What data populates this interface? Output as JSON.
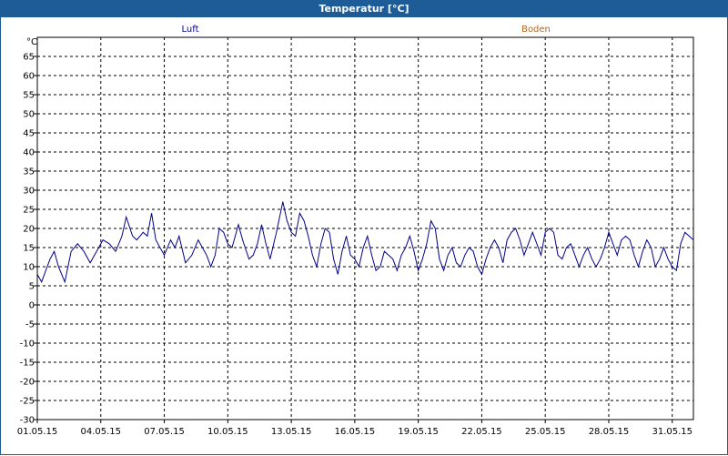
{
  "window": {
    "title": "Temperatur [°C]"
  },
  "chart_data": {
    "type": "line",
    "title": "Temperatur [°C]",
    "ylabel": "°C",
    "xlabel": "",
    "ylim": [
      -30,
      70
    ],
    "xlim": [
      0,
      31
    ],
    "grid": true,
    "legend_placement": "top",
    "yticks": [
      65,
      60,
      55,
      50,
      45,
      40,
      35,
      30,
      25,
      20,
      15,
      10,
      5,
      0,
      -5,
      -10,
      -15,
      -20,
      -25,
      -30
    ],
    "xticks": [
      {
        "label": "01.05.15",
        "day": 0
      },
      {
        "label": "04.05.15",
        "day": 3
      },
      {
        "label": "07.05.15",
        "day": 6
      },
      {
        "label": "10.05.15",
        "day": 9
      },
      {
        "label": "13.05.15",
        "day": 12
      },
      {
        "label": "16.05.15",
        "day": 15
      },
      {
        "label": "19.05.15",
        "day": 18
      },
      {
        "label": "22.05.15",
        "day": 21
      },
      {
        "label": "25.05.15",
        "day": 24
      },
      {
        "label": "28.05.15",
        "day": 27
      },
      {
        "label": "31.05.15",
        "day": 30
      }
    ],
    "series": [
      {
        "name": "Luft",
        "color": "#00008b",
        "points": [
          [
            0.0,
            8
          ],
          [
            0.2,
            6
          ],
          [
            0.4,
            9
          ],
          [
            0.6,
            12
          ],
          [
            0.8,
            14
          ],
          [
            1.0,
            10
          ],
          [
            1.3,
            6
          ],
          [
            1.6,
            14
          ],
          [
            1.9,
            16
          ],
          [
            2.2,
            14
          ],
          [
            2.5,
            11
          ],
          [
            2.8,
            14
          ],
          [
            3.1,
            17
          ],
          [
            3.4,
            16
          ],
          [
            3.7,
            14
          ],
          [
            4.0,
            18
          ],
          [
            4.2,
            23
          ],
          [
            4.5,
            18
          ],
          [
            4.7,
            17
          ],
          [
            5.0,
            19
          ],
          [
            5.2,
            18
          ],
          [
            5.4,
            24
          ],
          [
            5.6,
            17
          ],
          [
            6.0,
            13
          ],
          [
            6.3,
            17
          ],
          [
            6.5,
            15
          ],
          [
            6.7,
            18
          ],
          [
            7.0,
            11
          ],
          [
            7.3,
            13
          ],
          [
            7.6,
            17
          ],
          [
            7.8,
            15
          ],
          [
            8.0,
            13
          ],
          [
            8.2,
            10
          ],
          [
            8.4,
            13
          ],
          [
            8.6,
            20
          ],
          [
            8.8,
            19
          ],
          [
            9.0,
            16
          ],
          [
            9.2,
            15
          ],
          [
            9.5,
            21
          ],
          [
            9.7,
            17
          ],
          [
            10.0,
            12
          ],
          [
            10.2,
            13
          ],
          [
            10.4,
            16
          ],
          [
            10.6,
            21
          ],
          [
            10.8,
            16
          ],
          [
            11.0,
            12
          ],
          [
            11.3,
            19
          ],
          [
            11.6,
            27
          ],
          [
            11.8,
            22
          ],
          [
            12.0,
            19
          ],
          [
            12.2,
            18
          ],
          [
            12.4,
            24
          ],
          [
            12.6,
            22
          ],
          [
            12.8,
            18
          ],
          [
            13.0,
            13
          ],
          [
            13.2,
            10
          ],
          [
            13.4,
            16
          ],
          [
            13.6,
            20
          ],
          [
            13.8,
            19
          ],
          [
            14.0,
            12
          ],
          [
            14.2,
            8
          ],
          [
            14.4,
            14
          ],
          [
            14.6,
            18
          ],
          [
            14.8,
            13
          ],
          [
            15.0,
            12
          ],
          [
            15.2,
            10
          ],
          [
            15.4,
            15
          ],
          [
            15.6,
            18
          ],
          [
            15.8,
            13
          ],
          [
            16.0,
            9
          ],
          [
            16.2,
            10
          ],
          [
            16.4,
            14
          ],
          [
            16.6,
            13
          ],
          [
            16.8,
            12
          ],
          [
            17.0,
            9
          ],
          [
            17.2,
            13
          ],
          [
            17.4,
            15
          ],
          [
            17.6,
            18
          ],
          [
            17.8,
            14
          ],
          [
            18.0,
            9
          ],
          [
            18.2,
            12
          ],
          [
            18.4,
            16
          ],
          [
            18.6,
            22
          ],
          [
            18.8,
            20
          ],
          [
            19.0,
            12
          ],
          [
            19.2,
            9
          ],
          [
            19.4,
            13
          ],
          [
            19.6,
            15
          ],
          [
            19.8,
            11
          ],
          [
            20.0,
            10
          ],
          [
            20.2,
            13
          ],
          [
            20.4,
            15
          ],
          [
            20.6,
            14
          ],
          [
            20.8,
            10
          ],
          [
            21.0,
            8
          ],
          [
            21.2,
            12
          ],
          [
            21.4,
            15
          ],
          [
            21.6,
            17
          ],
          [
            21.8,
            15
          ],
          [
            22.0,
            11
          ],
          [
            22.2,
            17
          ],
          [
            22.4,
            19
          ],
          [
            22.6,
            20
          ],
          [
            22.8,
            17
          ],
          [
            23.0,
            13
          ],
          [
            23.2,
            16
          ],
          [
            23.4,
            19
          ],
          [
            23.6,
            16
          ],
          [
            23.8,
            13
          ],
          [
            24.0,
            19
          ],
          [
            24.2,
            20
          ],
          [
            24.4,
            19
          ],
          [
            24.6,
            13
          ],
          [
            24.8,
            12
          ],
          [
            25.0,
            15
          ],
          [
            25.2,
            16
          ],
          [
            25.4,
            13
          ],
          [
            25.6,
            10
          ],
          [
            25.8,
            13
          ],
          [
            26.0,
            15
          ],
          [
            26.2,
            12
          ],
          [
            26.4,
            10
          ],
          [
            26.6,
            12
          ],
          [
            26.8,
            15
          ],
          [
            27.0,
            19
          ],
          [
            27.2,
            16
          ],
          [
            27.4,
            13
          ],
          [
            27.6,
            17
          ],
          [
            27.8,
            18
          ],
          [
            28.0,
            17
          ],
          [
            28.2,
            13
          ],
          [
            28.4,
            10
          ],
          [
            28.6,
            14
          ],
          [
            28.8,
            17
          ],
          [
            29.0,
            15
          ],
          [
            29.2,
            10
          ],
          [
            29.4,
            12
          ],
          [
            29.6,
            15
          ],
          [
            29.8,
            12
          ],
          [
            30.0,
            10
          ],
          [
            30.2,
            9
          ],
          [
            30.4,
            16
          ],
          [
            30.6,
            19
          ],
          [
            30.8,
            18
          ],
          [
            31.0,
            17
          ]
        ]
      },
      {
        "name": "Boden",
        "color": "#b5651d",
        "points": []
      }
    ]
  }
}
